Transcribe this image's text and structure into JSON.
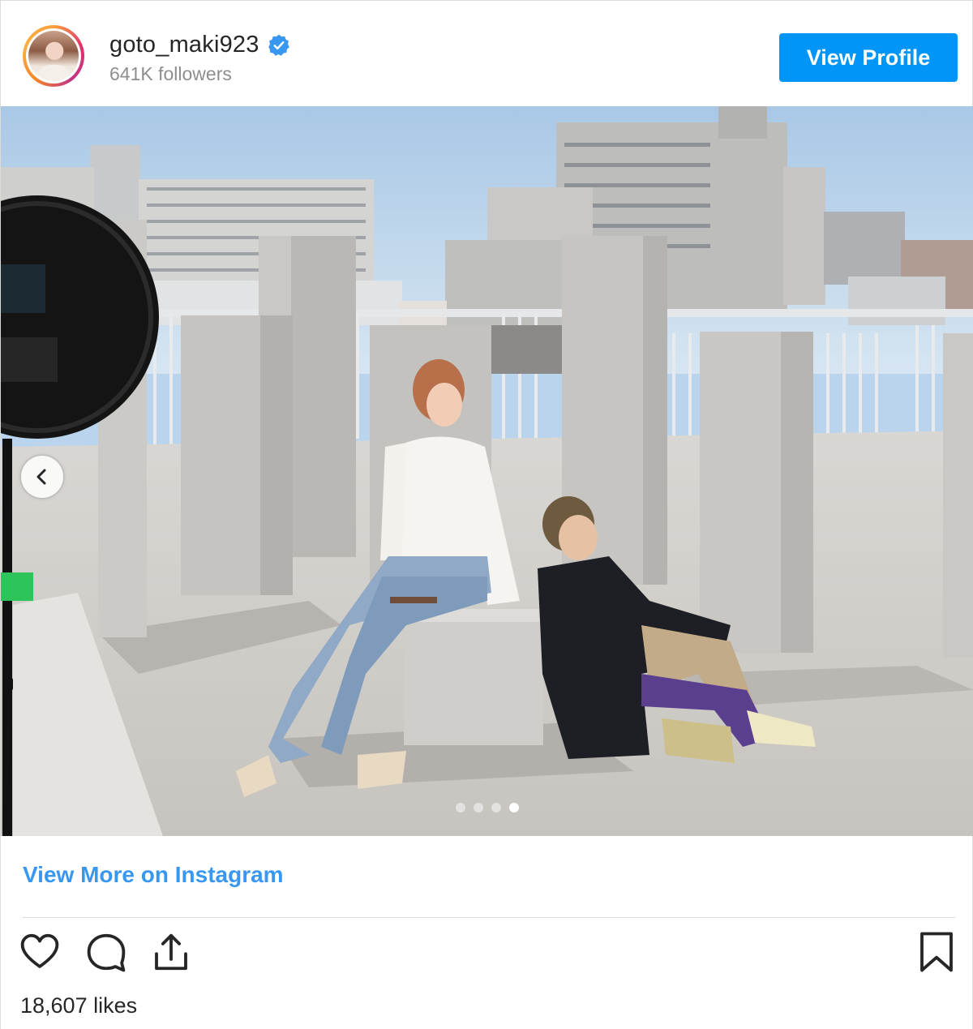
{
  "header": {
    "username": "goto_maki923",
    "followers": "641K followers",
    "view_profile_label": "View Profile",
    "verified_color": "#3897f0"
  },
  "post": {
    "slide_count": 4,
    "active_slide": 4,
    "prev_icon": "chevron-left-icon"
  },
  "footer": {
    "view_more_label": "View More on Instagram",
    "likes": "18,607 likes",
    "icons": [
      "heart-icon",
      "comment-icon",
      "share-icon",
      "bookmark-icon"
    ]
  },
  "colors": {
    "accent": "#0095f6",
    "link": "#3897f0",
    "muted": "#8e8e8e",
    "text": "#262626"
  }
}
